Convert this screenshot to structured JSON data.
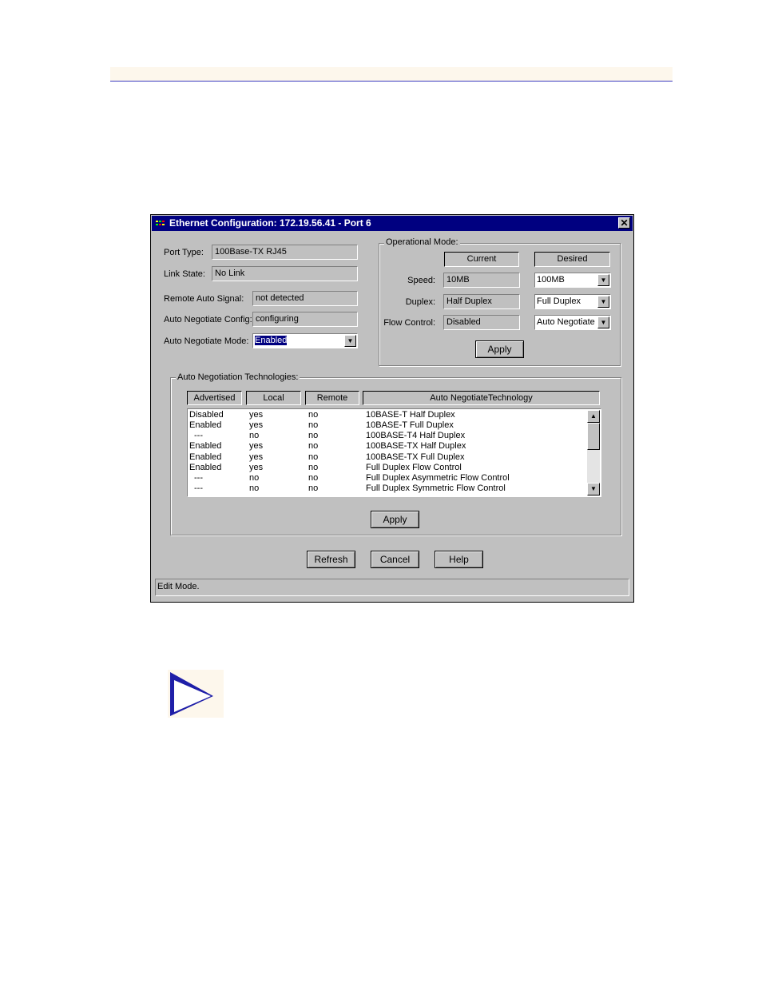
{
  "dialog": {
    "title": "Ethernet Configuration: 172.19.56.41 - Port 6",
    "close_glyph": "✕"
  },
  "port": {
    "type_label": "Port Type:",
    "type_value": "100Base-TX RJ45",
    "link_label": "Link State:",
    "link_value": "No Link",
    "remote_label": "Remote Auto Signal:",
    "remote_value": "not detected",
    "config_label": "Auto Negotiate Config:",
    "config_value": "configuring",
    "mode_label": "Auto Negotiate Mode:",
    "mode_value": "Enabled"
  },
  "op_mode": {
    "title": "Operational Mode:",
    "current_header": "Current",
    "desired_header": "Desired",
    "speed_label": "Speed:",
    "speed_current": "10MB",
    "speed_desired": "100MB",
    "duplex_label": "Duplex:",
    "duplex_current": "Half Duplex",
    "duplex_desired": "Full Duplex",
    "flow_label": "Flow Control:",
    "flow_current": "Disabled",
    "flow_desired": "Auto Negotiate",
    "apply_label": "Apply"
  },
  "tech": {
    "title": "Auto Negotiation Technologies:",
    "columns": [
      "Advertised",
      "Local",
      "Remote",
      "Auto NegotiateTechnology"
    ],
    "rows": [
      [
        "Disabled",
        "yes",
        "no",
        "10BASE-T Half Duplex"
      ],
      [
        "Enabled",
        "yes",
        "no",
        "10BASE-T Full Duplex"
      ],
      [
        "---",
        "no",
        "no",
        "100BASE-T4 Half Duplex"
      ],
      [
        "Enabled",
        "yes",
        "no",
        "100BASE-TX Half Duplex"
      ],
      [
        "Enabled",
        "yes",
        "no",
        "100BASE-TX Full Duplex"
      ],
      [
        "Enabled",
        "yes",
        "no",
        "Full Duplex Flow Control"
      ],
      [
        "---",
        "no",
        "no",
        "Full Duplex Asymmetric Flow Control"
      ],
      [
        "---",
        "no",
        "no",
        "Full Duplex Symmetric Flow Control"
      ]
    ],
    "apply_label": "Apply"
  },
  "buttons": {
    "refresh": "Refresh",
    "cancel": "Cancel",
    "help": "Help"
  },
  "status": "Edit Mode.",
  "colors": {
    "titlebar": "#000080",
    "dialog_face": "#c0c0c0",
    "note_arrow": "#1f1fa8"
  },
  "icons": {
    "note": "note-arrow-icon",
    "dropdown": "chevron-down-icon",
    "scroll_up": "scroll-up-icon",
    "scroll_down": "scroll-down-icon"
  }
}
